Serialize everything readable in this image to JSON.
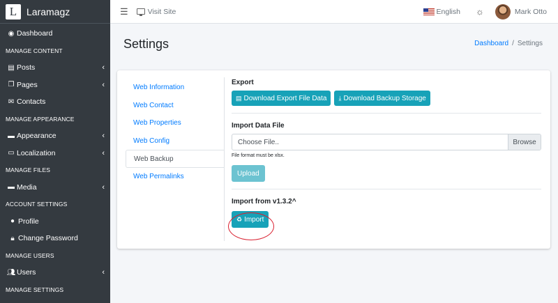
{
  "brand": {
    "logo_letter": "L",
    "name": "Laramagz"
  },
  "sidebar": {
    "items": [
      {
        "kind": "item",
        "icon": "tachometer-icon",
        "glyph": "◉",
        "label": "Dashboard",
        "arrow": false
      },
      {
        "kind": "header",
        "label": "MANAGE CONTENT"
      },
      {
        "kind": "item",
        "icon": "posts-icon",
        "glyph": "▤",
        "label": "Posts",
        "arrow": true
      },
      {
        "kind": "item",
        "icon": "pages-icon",
        "glyph": "❐",
        "label": "Pages",
        "arrow": true
      },
      {
        "kind": "item",
        "icon": "envelope-icon",
        "glyph": "✉",
        "label": "Contacts",
        "arrow": false
      },
      {
        "kind": "header",
        "label": "MANAGE APPEARANCE"
      },
      {
        "kind": "item",
        "icon": "paint-roller-icon",
        "glyph": "▬",
        "label": "Appearance",
        "arrow": true
      },
      {
        "kind": "item",
        "icon": "language-icon",
        "glyph": "▭",
        "label": "Localization",
        "arrow": true
      },
      {
        "kind": "header",
        "label": "MANAGE FILES"
      },
      {
        "kind": "item",
        "icon": "hdd-icon",
        "glyph": "▬",
        "label": "Media",
        "arrow": true
      },
      {
        "kind": "header",
        "label": "ACCOUNT SETTINGS"
      },
      {
        "kind": "item",
        "icon": "user-icon",
        "glyph": "●",
        "label": "Profile",
        "arrow": false,
        "sub": true
      },
      {
        "kind": "item",
        "icon": "lock-icon",
        "glyph": "🔒︎",
        "label": "Change Password",
        "arrow": false,
        "sub": true
      },
      {
        "kind": "header",
        "label": "MANAGE USERS"
      },
      {
        "kind": "item",
        "icon": "users-icon",
        "glyph": "👥︎",
        "label": "Users",
        "arrow": true
      },
      {
        "kind": "header",
        "label": "MANAGE SETTINGS"
      }
    ],
    "arrow_glyph": "‹"
  },
  "topbar": {
    "visit_site": "Visit Site",
    "language": "English",
    "user_name": "Mark Otto"
  },
  "page": {
    "title": "Settings",
    "breadcrumb": [
      "Dashboard",
      "/",
      "Settings"
    ]
  },
  "tabs": [
    {
      "label": "Web Information",
      "active": false
    },
    {
      "label": "Web Contact",
      "active": false
    },
    {
      "label": "Web Properties",
      "active": false
    },
    {
      "label": "Web Config",
      "active": false
    },
    {
      "label": "Web Backup",
      "active": true
    },
    {
      "label": "Web Permalinks",
      "active": false
    }
  ],
  "backup": {
    "export_title": "Export",
    "download_export_label": "Download Export File Data",
    "download_backup_label": "Download Backup Storage",
    "import_title": "Import Data File",
    "file_placeholder": "Choose File..",
    "browse_label": "Browse",
    "file_hint": "File format must be xlsx.",
    "upload_label": "Upload",
    "import_v_title": "Import from v1.3.2^",
    "import_label": "Import"
  },
  "colors": {
    "accent": "#17a2b8",
    "sidebar_bg": "#343a40",
    "annotation": "#d91f2f"
  }
}
